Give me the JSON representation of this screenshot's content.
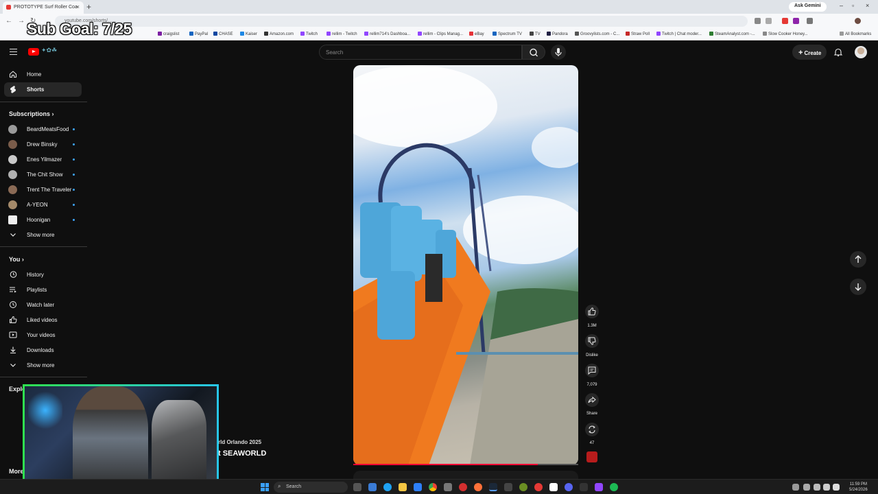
{
  "browser": {
    "tab_title": "PROTOTYPE Surf Roller Coa",
    "url": "youtube.com/shorts/...",
    "ask_gemini": "Ask Gemini",
    "bookmarks": [
      "craigslist",
      "PayPal",
      "CHASE",
      "Kaiser",
      "Amazon.com",
      "Twitch",
      "rellim - Twitch",
      "rellim714's Dashboa...",
      "rellim - Clips Manag...",
      "eBay",
      "Spectrum TV",
      "TV",
      "Pandora",
      "Groovylists.com - C...",
      "Straw Poll",
      "Twitch | Chat moder...",
      "SteamAnalyst.com -...",
      "Slow Cooker Honey..."
    ],
    "all_bookmarks": "All Bookmarks"
  },
  "overlay": {
    "sub_goal": "Sub Goal: 7/25"
  },
  "header": {
    "search_placeholder": "Search",
    "create_label": "Create"
  },
  "sidebar": {
    "main": [
      {
        "label": "Home",
        "icon": "home-icon"
      },
      {
        "label": "Shorts",
        "icon": "shorts-icon",
        "active": true
      }
    ],
    "subscriptions_title": "Subscriptions",
    "subscriptions": [
      {
        "label": "BeardMeatsFood",
        "color": "#9a9a9a"
      },
      {
        "label": "Drew Binsky",
        "color": "#7a5c4a"
      },
      {
        "label": "Enes Yilmazer",
        "color": "#c9c9c9"
      },
      {
        "label": "The Chit Show",
        "color": "#b0b0b0"
      },
      {
        "label": "Trent The Traveler",
        "color": "#8a6a55"
      },
      {
        "label": "A-YEON",
        "color": "#a58a6a"
      },
      {
        "label": "Hoonigan",
        "color": "#eeeeee"
      }
    ],
    "show_more": "Show more",
    "you_title": "You",
    "you": [
      {
        "label": "History",
        "icon": "history-icon"
      },
      {
        "label": "Playlists",
        "icon": "playlists-icon"
      },
      {
        "label": "Watch later",
        "icon": "watch-later-icon"
      },
      {
        "label": "Liked videos",
        "icon": "liked-videos-icon"
      },
      {
        "label": "Your videos",
        "icon": "your-videos-icon"
      },
      {
        "label": "Downloads",
        "icon": "downloads-icon"
      }
    ],
    "show_more_2": "Show more",
    "explore_title": "Explo",
    "more_title": "More"
  },
  "video": {
    "title_line1": "rld Orlando 2025",
    "title_line2": "t SEAWORLD",
    "progress": 0.82
  },
  "actions": {
    "likes": "1.3M",
    "dislike": "Dislike",
    "comments": "7,079",
    "share": "Share",
    "remix": "47"
  },
  "taskbar": {
    "search": "Search",
    "time": "11:59 PM",
    "date": "5/24/2026"
  },
  "colors": {
    "accent_red": "#ff0000",
    "background": "#0f0f0f",
    "webcam_border_start": "#2fe04f",
    "webcam_border_end": "#27c6e8"
  }
}
